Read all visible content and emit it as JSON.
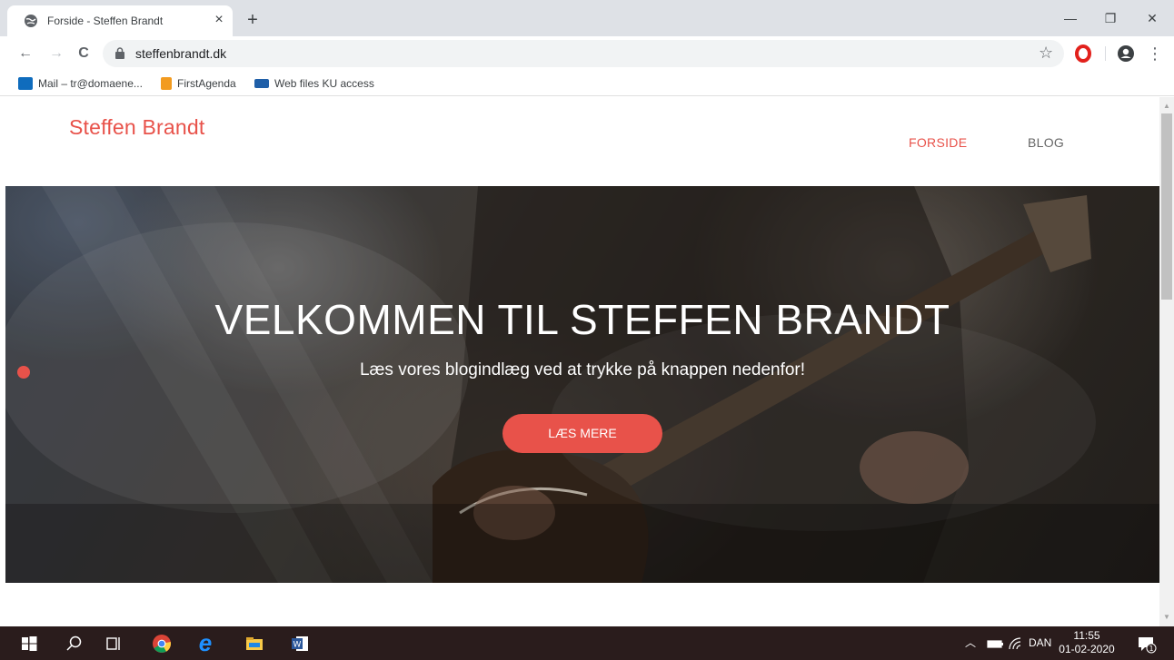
{
  "browser": {
    "tab_title": "Forside - Steffen Brandt",
    "tab_close": "×",
    "new_tab": "+",
    "window_controls": {
      "minimize": "—",
      "restore": "❐",
      "close": "✕"
    },
    "nav": {
      "back": "←",
      "forward": "→",
      "reload": "C"
    },
    "url": "steffenbrandt.dk",
    "menu": "⋮",
    "bookmarks": [
      {
        "label": "Mail – tr@domaene...",
        "icon": "outlook-icon"
      },
      {
        "label": "FirstAgenda",
        "icon": "firstagenda-icon"
      },
      {
        "label": "Web files KU access",
        "icon": "drive-icon"
      }
    ]
  },
  "site": {
    "logo": "Steffen Brandt",
    "nav": [
      {
        "label": "FORSIDE",
        "active": true
      },
      {
        "label": "BLOG",
        "active": false
      }
    ],
    "hero": {
      "title": "VELKOMMEN TIL STEFFEN BRANDT",
      "subtitle": "Læs vores blogindlæg ved at trykke på knappen nedenfor!",
      "button": "LÆS MERE"
    }
  },
  "colors": {
    "accent": "#e8524a",
    "nav_inactive": "#666666",
    "taskbar": "#2a1c1c"
  },
  "taskbar": {
    "tray_language": "DAN",
    "time": "11:55",
    "date": "01-02-2020",
    "notification_count": "1"
  }
}
